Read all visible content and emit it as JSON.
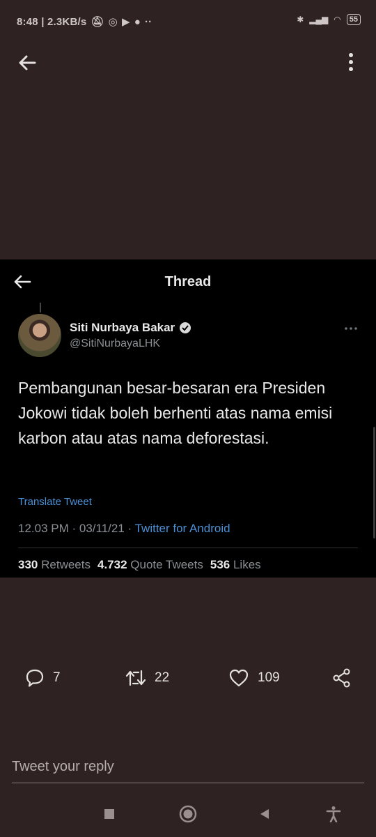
{
  "status_bar": {
    "time_info": "8:48 | 2.3KB/s",
    "battery": "55"
  },
  "tweet_image": {
    "header_title": "Thread",
    "author": {
      "name": "Siti Nurbaya Bakar",
      "handle": "@SitiNurbayaLHK"
    },
    "text": "Pembangunan besar-besaran era Presiden Jokowi tidak boleh berhenti atas nama emisi karbon atau atas nama deforestasi.",
    "translate_label": "Translate Tweet",
    "timestamp": "12.03 PM · 03/11/21 · ",
    "source": "Twitter for Android",
    "stats": {
      "retweets_count": "330",
      "retweets_label": "Retweets",
      "quotes_count": "4.732",
      "quotes_label": "Quote Tweets",
      "likes_count": "536",
      "likes_label": "Likes"
    }
  },
  "actions": {
    "reply_count": "7",
    "retweet_count": "22",
    "like_count": "109"
  },
  "reply": {
    "placeholder": "Tweet your reply"
  },
  "icons": [
    "back-arrow-icon",
    "more-vertical-icon",
    "verified-badge-icon",
    "more-horizontal-icon",
    "comment-icon",
    "retweet-icon",
    "heart-icon",
    "share-icon",
    "square-nav-icon",
    "home-nav-icon",
    "back-nav-icon",
    "accessibility-icon"
  ],
  "colors": {
    "background": "#2e2222",
    "card": "#000000",
    "link": "#4a90d6"
  }
}
